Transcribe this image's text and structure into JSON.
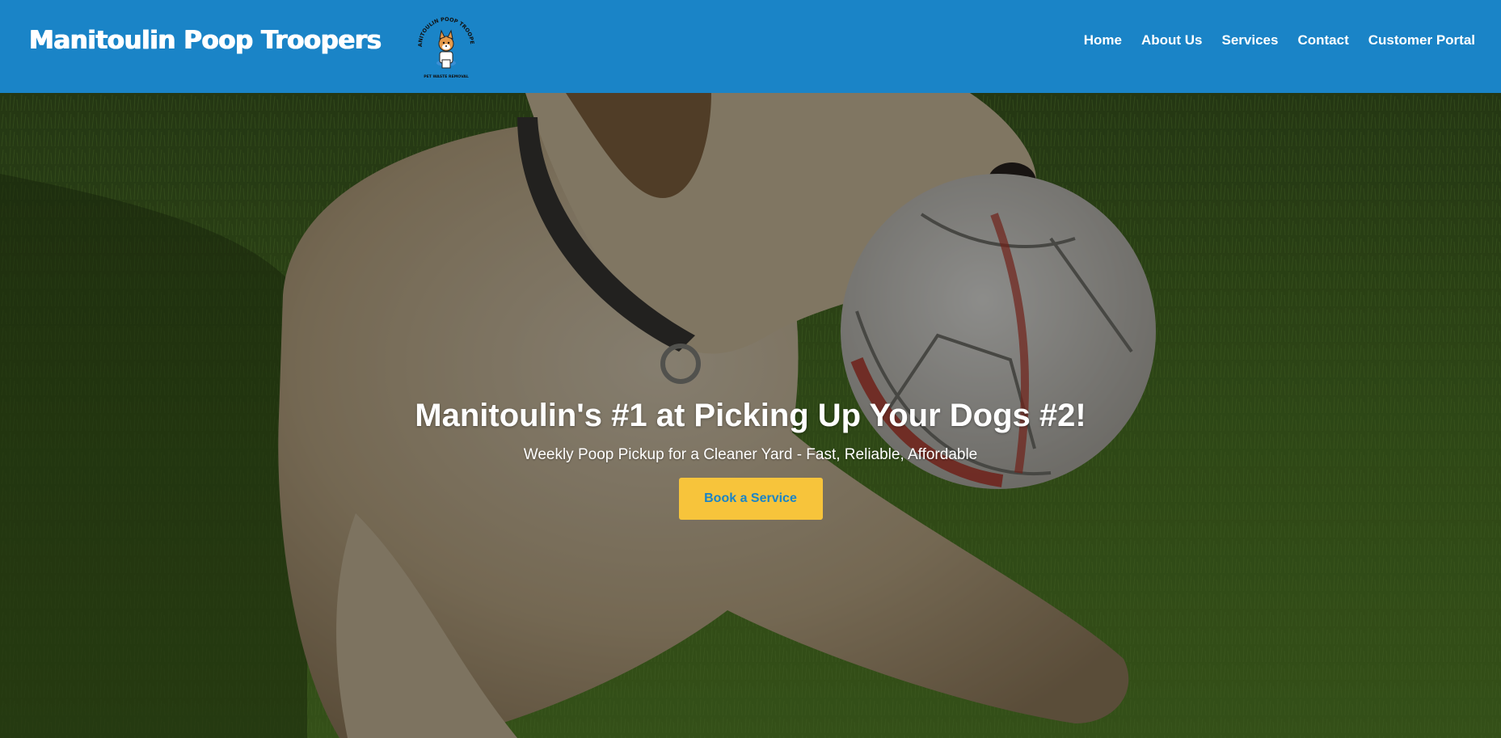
{
  "header": {
    "brand_name": "Manitoulin Poop Troopers",
    "logo": {
      "arc_text": "MANITOULIN POOP TROOPERS",
      "bottom_text": "PET WASTE REMOVAL",
      "icon": "dog-on-toilet-icon"
    },
    "nav": [
      {
        "label": "Home"
      },
      {
        "label": "About Us"
      },
      {
        "label": "Services"
      },
      {
        "label": "Contact"
      },
      {
        "label": "Customer Portal"
      }
    ]
  },
  "hero": {
    "background": "photo of labrador dog holding a soccer ball on grass",
    "title": "Manitoulin's #1 at Picking Up Your Dogs #2!",
    "subtitle": "Weekly Poop Pickup for a Cleaner Yard - Fast, Reliable, Affordable",
    "cta_label": "Book a Service"
  },
  "colors": {
    "header_bg": "#1a84c7",
    "cta_bg": "#f7c43b",
    "cta_text": "#1a84c7",
    "text_light": "#ffffff"
  }
}
